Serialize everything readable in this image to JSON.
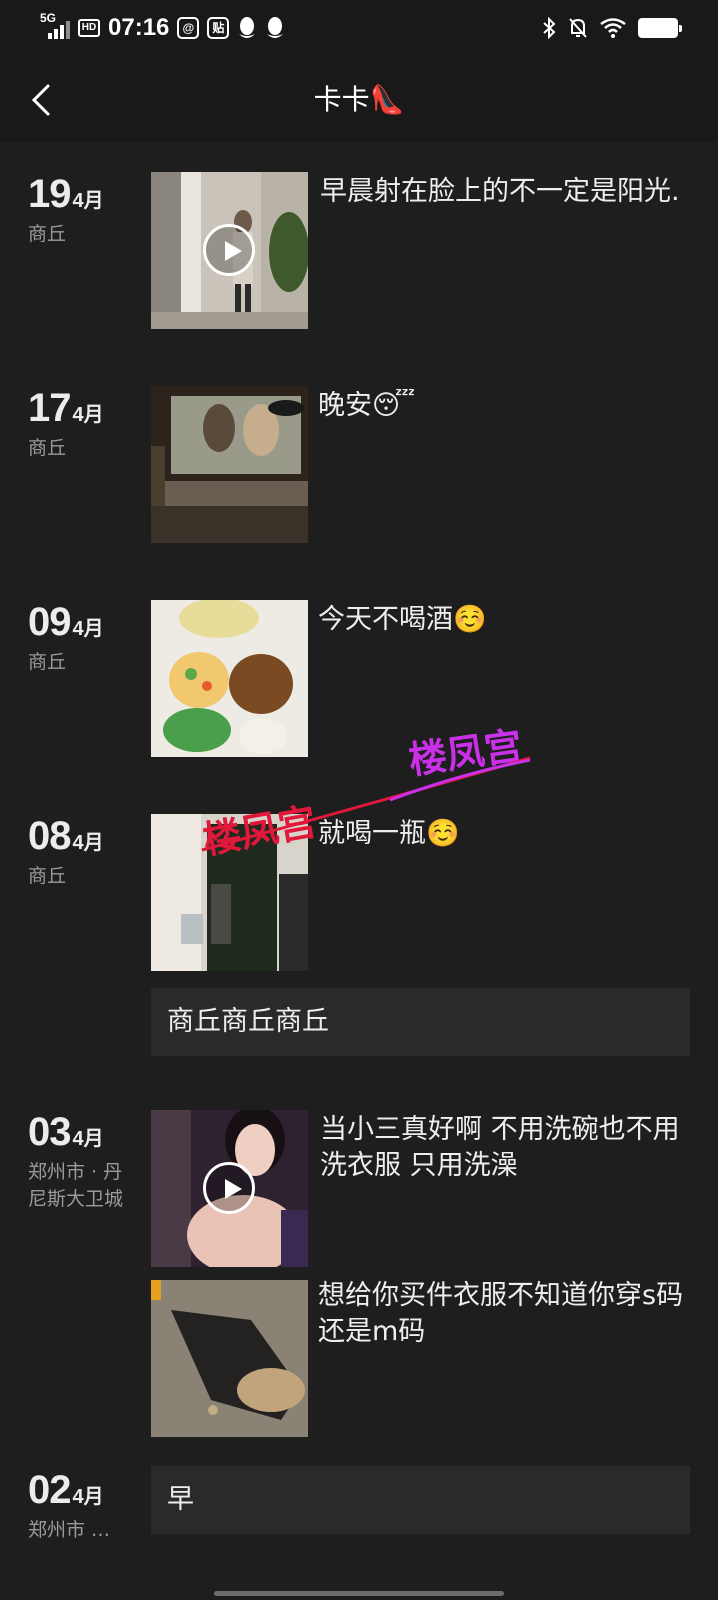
{
  "status_bar": {
    "network": "5G",
    "hd": "HD",
    "time": "07:16",
    "app_icon_1": "@",
    "app_icon_2": "贴",
    "battery": "99",
    "icons": [
      "signal-icon",
      "hd-icon",
      "at-app-icon",
      "tieba-app-icon",
      "qq-icon",
      "qq-icon",
      "bluetooth-icon",
      "mute-bell-icon",
      "wifi-icon",
      "battery-icon"
    ]
  },
  "header": {
    "title": "卡卡👠",
    "back_icon": "chevron-left-icon"
  },
  "entries": [
    {
      "day": "19",
      "month": "4月",
      "location": "商丘",
      "caption": "早晨射在脸上的不一定是阳光.",
      "has_video": true
    },
    {
      "day": "17",
      "month": "4月",
      "location": "商丘",
      "caption": "晚安😴",
      "has_video": false
    },
    {
      "day": "09",
      "month": "4月",
      "location": "商丘",
      "caption": "今天不喝酒☺️",
      "has_video": false
    },
    {
      "day": "08",
      "month": "4月",
      "location": "商丘",
      "caption": "就喝一瓶☺️",
      "text_card": "商丘商丘商丘",
      "has_video": false
    },
    {
      "day": "03",
      "month": "4月",
      "location": "郑州市 · 丹尼斯大卫城",
      "caption": "当小三真好啊 不用洗碗也不用洗衣服 只用洗澡",
      "caption_2": "想给你买件衣服不知道你穿s码还是m码",
      "has_video": true
    },
    {
      "day": "02",
      "month": "4月",
      "location": "郑州市 …",
      "text_card": "早"
    }
  ],
  "watermarks": [
    "楼凤宫",
    "楼凤宫"
  ],
  "colors": {
    "background": "#1e1e1e",
    "bar": "#191919",
    "card": "#2a2a2a",
    "watermark_red": "#e0183a",
    "watermark_purple": "#c930e8"
  }
}
